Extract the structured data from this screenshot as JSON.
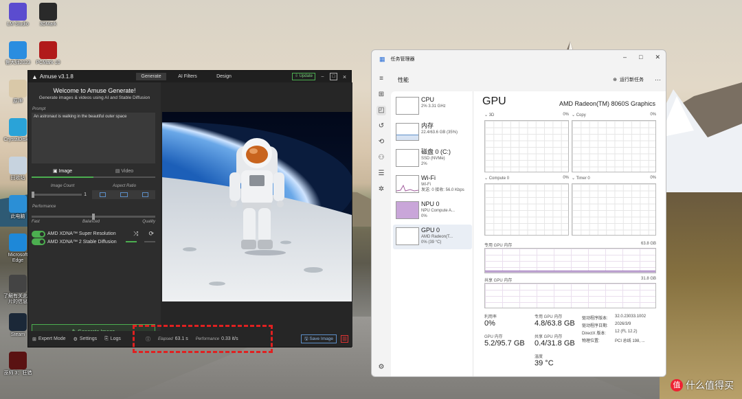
{
  "desktop": {
    "icons": [
      {
        "label": "LM Studio",
        "color": "#5b4ccf"
      },
      {
        "label": "3DMark",
        "color": "#2a2a2a"
      },
      {
        "label": "鲁大师2023",
        "color": "#2a8de0"
      },
      {
        "label": "PCMark 10",
        "color": "#b11a1a"
      },
      {
        "label": "原神",
        "color": "#d9c8a8"
      },
      {
        "label": "CrystalDisk 8",
        "color": "#2aa3d8"
      },
      {
        "label": "回收站",
        "color": "#c7d3df"
      },
      {
        "label": "此电脑",
        "color": "#2b8fd6"
      },
      {
        "label": "Microsoft Edge",
        "color": "#1e88d8"
      },
      {
        "label": "了解有关此图片的信息",
        "color": "#444444"
      },
      {
        "label": "Steam",
        "color": "#1b2838"
      },
      {
        "label": "巫师 3：狂猎",
        "color": "#5a1212"
      }
    ]
  },
  "amuse": {
    "title": "Amuse v3.1.8",
    "nav": [
      "Generate",
      "AI Filters",
      "Design"
    ],
    "update_label": "Update",
    "welcome": "Welcome to Amuse Generate!",
    "subwelcome": "Generate images & videos using AI and Stable Diffusion",
    "prompt_label": "Prompt",
    "prompt_text": "An astronaut is walking in the beautiful outer space",
    "tab_image": "Image",
    "tab_video": "Video",
    "image_count_label": "Image Count",
    "image_count_value": "1",
    "aspect_ratio_label": "Aspect Ratio",
    "performance_label": "Performance",
    "perf_fast": "Fast",
    "perf_balanced": "Balanced",
    "perf_quality": "Quality",
    "toggle1": "AMD XDNA™ Super Resolution",
    "toggle2": "AMD XDNA™ 2 Stable Diffusion",
    "generate_label": "Generate Image",
    "expert_mode": "Expert Mode",
    "settings": "Settings",
    "logs": "Logs",
    "elapsed_label": "Elapsed",
    "elapsed_value": "63.1 s",
    "performance_stat_label": "Performance",
    "performance_stat_value": "0.33 it/s",
    "save_label": "Save Image",
    "accent": "#4caf50"
  },
  "taskmgr": {
    "title": "任务管理器",
    "section": "性能",
    "new_task": "运行新任务",
    "more": "···",
    "devices": [
      {
        "name": "CPU",
        "sub1": "2% 3.31 GHz",
        "sub2": ""
      },
      {
        "name": "内存",
        "sub1": "22.4/63.6 GB (35%)",
        "sub2": ""
      },
      {
        "name": "磁盘 0 (C:)",
        "sub1": "SSD (NVMe)",
        "sub2": "2%"
      },
      {
        "name": "Wi-Fi",
        "sub1": "Wi-Fi",
        "sub2": "发送: 0 接收: 56.0 Kbps"
      },
      {
        "name": "NPU 0",
        "sub1": "NPU Compute A...",
        "sub2": "0%"
      },
      {
        "name": "GPU 0",
        "sub1": "AMD Radeon(T...",
        "sub2": "0% (39 °C)"
      }
    ],
    "gpu_title": "GPU",
    "gpu_name": "AMD Radeon(TM) 8060S Graphics",
    "engines": [
      {
        "name": "3D",
        "pct": "0%"
      },
      {
        "name": "Copy",
        "pct": "0%"
      },
      {
        "name": "Compute 0",
        "pct": "0%"
      },
      {
        "name": "Timer 0",
        "pct": "0%"
      }
    ],
    "dedicated_label": "专用 GPU 内存",
    "dedicated_max": "63.8 GB",
    "shared_label": "共享 GPU 内存",
    "shared_max": "31.8 GB",
    "utilization_label": "利用率",
    "utilization_value": "0%",
    "gpu_mem_label": "GPU 内存",
    "gpu_mem_value": "5.2/95.7 GB",
    "ded_mem_label": "专用 GPU 内存",
    "ded_mem_value": "4.8/63.8 GB",
    "shared_mem_label": "共享 GPU 内存",
    "shared_mem_value": "0.4/31.8 GB",
    "temp_label": "温度",
    "temp_value": "39 °C",
    "driver_version_label": "驱动程序版本:",
    "driver_version": "32.0.23033.1002",
    "driver_date_label": "驱动程序日期:",
    "driver_date": "2026/3/9",
    "directx_label": "DirectX 版本:",
    "directx": "12 (FL 12.2)",
    "location_label": "物理位置:",
    "location": "PCI 总线 198, ..."
  },
  "watermark": "什么值得买"
}
